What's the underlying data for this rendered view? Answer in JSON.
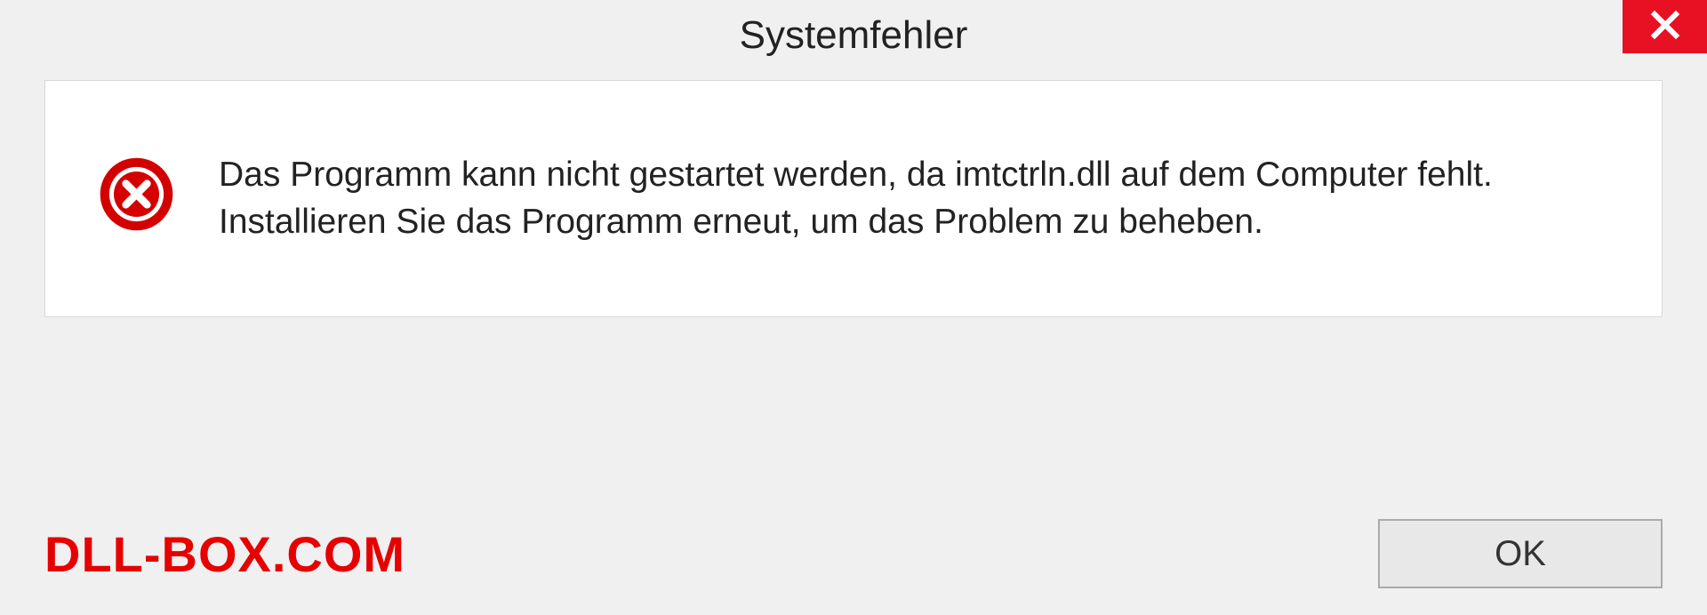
{
  "dialog": {
    "title": "Systemfehler",
    "message": "Das Programm kann nicht gestartet werden, da imtctrln.dll auf dem Computer fehlt. Installieren Sie das Programm erneut, um das Problem zu beheben.",
    "ok_label": "OK"
  },
  "watermark": "DLL-BOX.COM",
  "colors": {
    "close_bg": "#e81123",
    "error_red": "#d40000",
    "watermark_red": "#e60000"
  }
}
